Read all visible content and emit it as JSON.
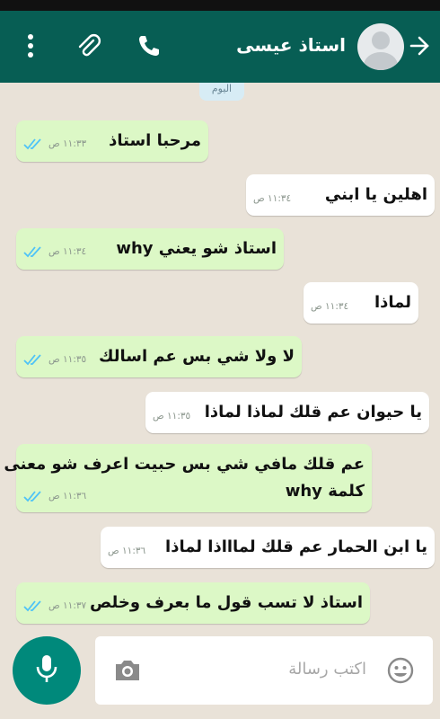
{
  "header": {
    "contact_name": "استاذ عيسى"
  },
  "chat": {
    "day_label": "اليوم",
    "messages": [
      {
        "direction": "out",
        "text": "مرحبا استاذ",
        "time": "١١:٣٣ ص"
      },
      {
        "direction": "in",
        "text": "اهلين يا ابني",
        "time": "١١:٣٤ ص"
      },
      {
        "direction": "out",
        "text": "استاذ شو يعني why",
        "time": "١١:٣٤ ص"
      },
      {
        "direction": "in",
        "text": "لماذا",
        "time": "١١:٣٤ ص"
      },
      {
        "direction": "out",
        "text": "لا ولا شي بس عم اسالك",
        "time": "١١:٣٥ ص"
      },
      {
        "direction": "in",
        "text": "يا حيوان عم قلك لماذا لماذا",
        "time": "١١:٣٥ ص"
      },
      {
        "direction": "out",
        "text_line1": "عم قلك مافي شي بس حبيت اعرف شو معنى",
        "text_line2": "كلمة why",
        "time": "١١:٣٦ ص"
      },
      {
        "direction": "in",
        "text": "يا ابن الحمار عم قلك لماااذا لماذا",
        "time": "١١:٣٦ ص"
      },
      {
        "direction": "out",
        "text": "استاذ لا تسب قول ما بعرف وخلص",
        "time": "١١:٣٧ ص"
      }
    ]
  },
  "composer": {
    "placeholder": "اكتب رسالة"
  },
  "colors": {
    "header": "#075e54",
    "outgoing_bubble": "#dcf8c6",
    "incoming_bubble": "#ffffff",
    "mic_button": "#00897b",
    "read_ticks": "#4fc3f7"
  },
  "icons": [
    "back-arrow-icon",
    "avatar-icon",
    "phone-icon",
    "attach-icon",
    "menu-icon",
    "double-check-icon",
    "mic-icon",
    "camera-icon",
    "emoji-icon"
  ]
}
